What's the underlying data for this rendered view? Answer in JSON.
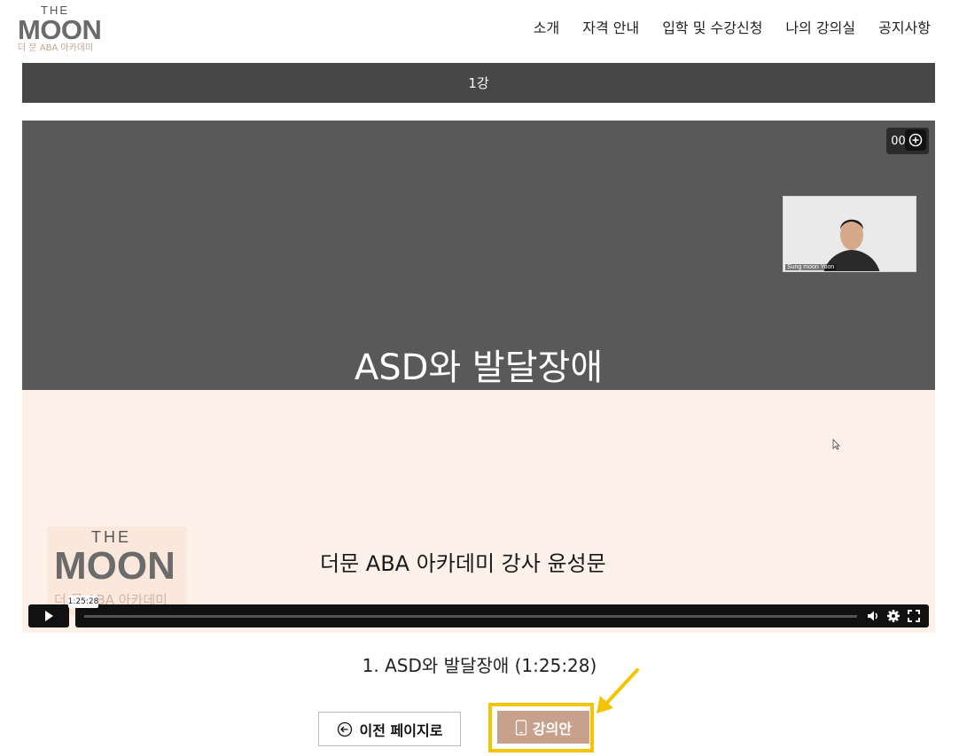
{
  "header": {
    "logo_the": "THE",
    "logo_word": "MOON",
    "logo_sub": "더 문 ABA 아카데미",
    "nav": [
      "소개",
      "자격 안내",
      "입학 및 수강신청",
      "나의 강의실",
      "공지사항"
    ]
  },
  "lesson_bar": {
    "label": "1강"
  },
  "video": {
    "title": "ASD와 발달장애",
    "timecode": "00:00",
    "webcam_name": "Sung moon Yoon",
    "watermark_the": "THE",
    "watermark_word": "MOON",
    "watermark_sub": "더 문 ABA 아카데미",
    "instructor": "더문 ABA 아카데미 강사 윤성문",
    "hover_time": "1:25:28",
    "progress": 0.0
  },
  "lecture": {
    "title": "1. ASD와 발달장애 (1:25:28)"
  },
  "buttons": {
    "prev": "이전 페이지로",
    "notes": "강의안"
  },
  "colors": {
    "accent": "#c8a18d",
    "highlight": "#f5c400",
    "bar": "#474747"
  }
}
